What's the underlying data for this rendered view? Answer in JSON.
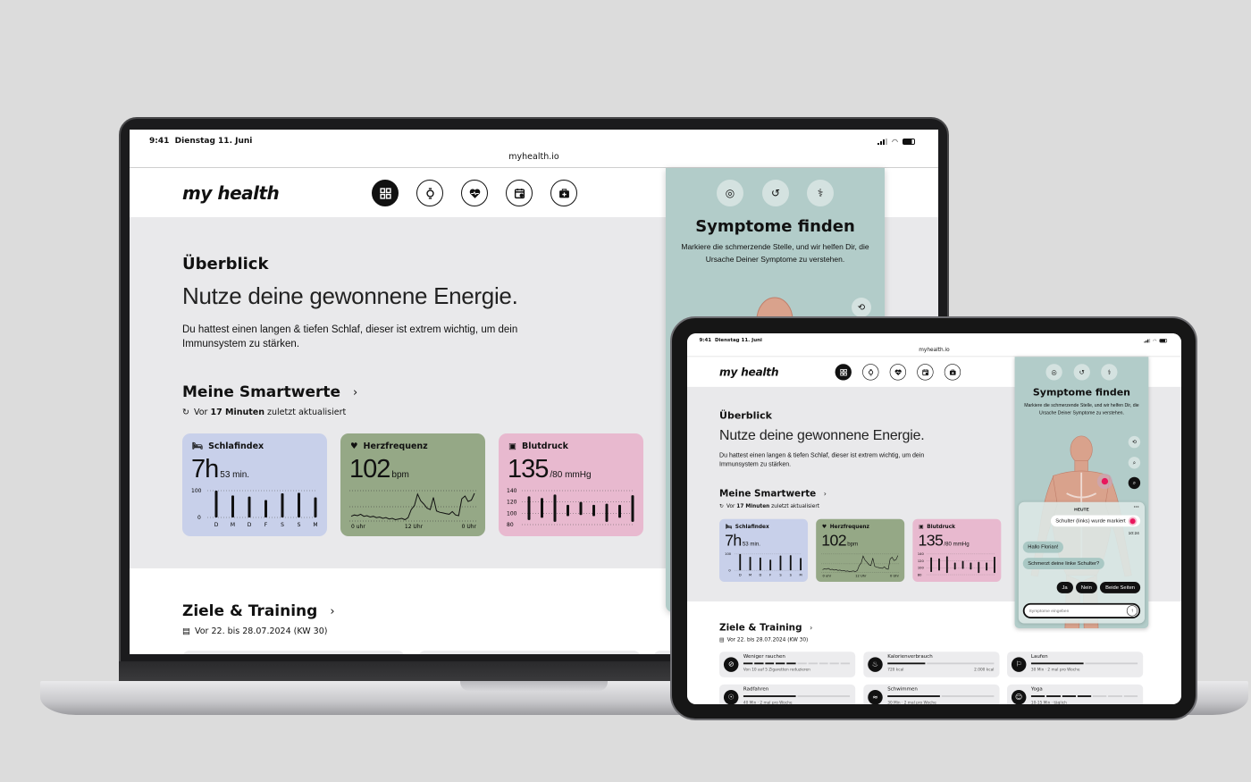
{
  "status": {
    "time": "9:41",
    "date": "Dienstag 11. Juni",
    "url": "myhealth.io"
  },
  "header": {
    "logo": "my health",
    "nav": [
      {
        "icon": "grid-icon",
        "active": true
      },
      {
        "icon": "watch-icon",
        "active": false
      },
      {
        "icon": "heart-pulse-icon",
        "active": false
      },
      {
        "icon": "calendar-icon",
        "active": false
      },
      {
        "icon": "medical-bag-icon",
        "active": false
      }
    ]
  },
  "overview": {
    "title": "Überblick",
    "headline": "Nutze deine gewonnene Energie.",
    "text": "Du hattest einen langen & tiefen Schlaf, dieser ist extrem wichtig, um dein Immunsystem zu stärken."
  },
  "smart": {
    "title": "Meine Smartwerte",
    "sub_prefix": "Vor",
    "sub_bold": "17 Minuten",
    "sub_suffix": "zuletzt aktualisiert",
    "cards": {
      "sleep": {
        "label": "Schlafindex",
        "value": "7h",
        "unit": "53 min.",
        "color": "#c8d0ea"
      },
      "heart": {
        "label": "Herzfrequenz",
        "value": "102",
        "unit": "bpm",
        "color": "#95a886"
      },
      "bp": {
        "label": "Blutdruck",
        "value": "135",
        "unit": "/80 mmHg",
        "color": "#e8b9cf"
      }
    }
  },
  "chart_data": [
    {
      "type": "bar",
      "categories": [
        "D",
        "M",
        "D",
        "F",
        "S",
        "S",
        "M"
      ],
      "values": [
        100,
        82,
        78,
        65,
        90,
        92,
        75
      ],
      "yticks": [
        "100",
        "0"
      ],
      "ylim": [
        0,
        100
      ]
    },
    {
      "type": "line",
      "xticks": [
        "0 uhr",
        "12 Uhr",
        "0 Uhr"
      ],
      "values": [
        62,
        64,
        63,
        65,
        62,
        63,
        61,
        62,
        60,
        61,
        59,
        60,
        58,
        59,
        57,
        58,
        59,
        57,
        60,
        72,
        78,
        95,
        85,
        80,
        74,
        72,
        90,
        70,
        68,
        67,
        66,
        65,
        69,
        64,
        63,
        88,
        92,
        84,
        86,
        96
      ]
    },
    {
      "type": "bar",
      "yticks": [
        "140",
        "120",
        "100",
        "80"
      ],
      "ylim": [
        80,
        140
      ],
      "ranges": [
        [
          88,
          130
        ],
        [
          92,
          127
        ],
        [
          85,
          133
        ],
        [
          95,
          115
        ],
        [
          97,
          120
        ],
        [
          95,
          115
        ],
        [
          85,
          117
        ],
        [
          92,
          115
        ],
        [
          85,
          132
        ]
      ]
    }
  ],
  "goals": {
    "title": "Ziele & Training",
    "sub": "Vor 22. bis 28.07.2024 (KW 30)",
    "items": [
      {
        "title": "Weniger rauchen",
        "sub": "Von 10 auf 5 Zigaretten reduzieren",
        "icon": "no-smoking-icon",
        "segments": 10,
        "done": 5
      },
      {
        "title": "Kalorienverbrauch",
        "sub": "720 kcal",
        "sub_right": "2.000 kcal",
        "icon": "flame-icon",
        "progress": 0.36
      },
      {
        "title": "Laufen",
        "sub": "30 Min · 2 mal pro Woche",
        "icon": "walking-icon",
        "progress": 0.5
      },
      {
        "title": "Radfahren",
        "sub": "40 Min · 2 mal pro Woche",
        "icon": "bicycle-icon",
        "progress": 0.5
      },
      {
        "title": "Schwimmen",
        "sub": "30 Min · 2 mal pro Woche",
        "icon": "swimming-icon",
        "progress": 0.5
      },
      {
        "title": "Yoga",
        "sub": "10-15 Min · täglich",
        "icon": "yoga-icon",
        "segments": 7,
        "done": 4
      }
    ]
  },
  "symptoms": {
    "title": "Symptome finden",
    "text": "Markiere die schmerzende Stelle, und wir helfen Dir, die Ursache Deiner Symptome zu verstehen.",
    "chat": {
      "day": "HEUTE",
      "marked": "Schulter (links) wurde markiert",
      "time": "10:24",
      "greeting": "Hallo Florian!",
      "question": "Schmerzt deine linke Schulter?",
      "answers": [
        "Ja",
        "Nein",
        "Beide Seiten"
      ],
      "placeholder": "Symptome eingeben"
    },
    "marker_color": "#e8175d"
  }
}
